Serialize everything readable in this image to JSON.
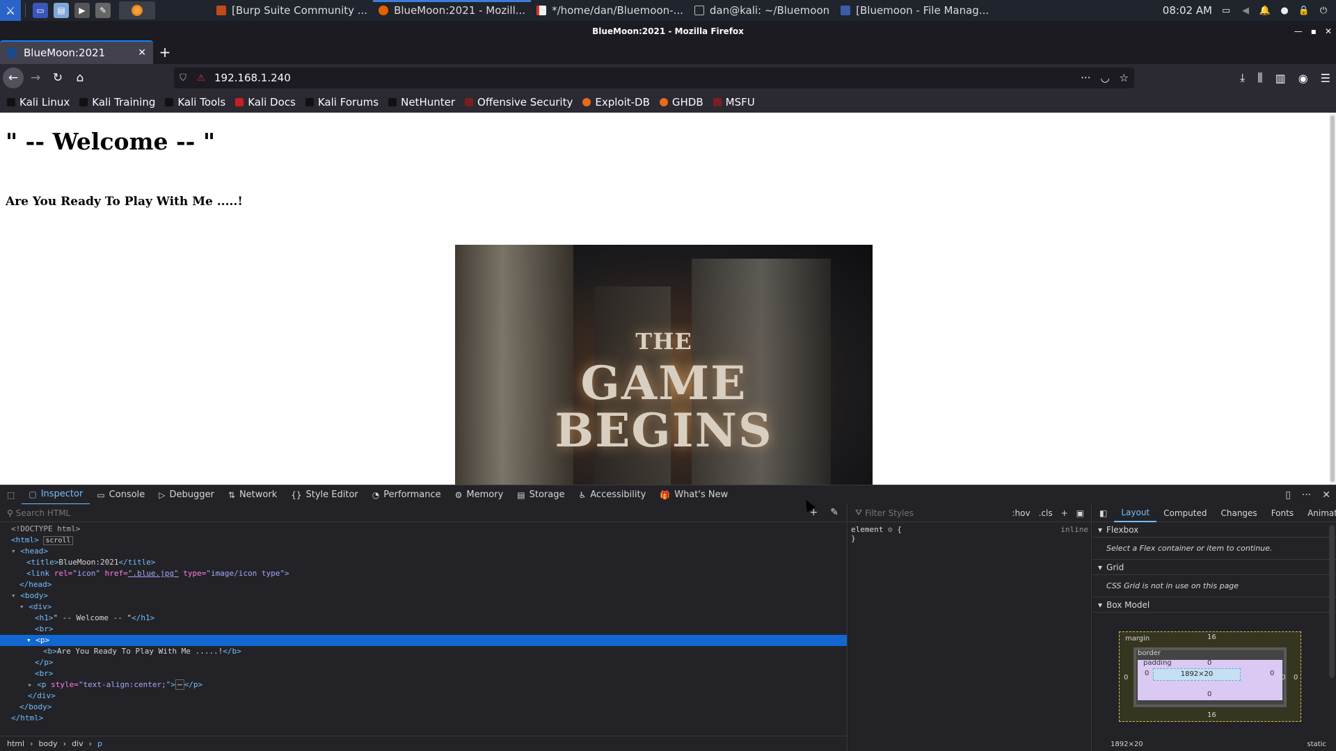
{
  "taskbar": {
    "windows": [
      {
        "label": "[Burp Suite Community ...",
        "color": "#c04a1a"
      },
      {
        "label": "BlueMoon:2021 - Mozill...",
        "color": "#e66000",
        "active": true
      },
      {
        "label": "*/home/dan/Bluemoon-...",
        "color": "#d33"
      },
      {
        "label": "dan@kali: ~/Bluemoon",
        "color": "#444"
      },
      {
        "label": "[Bluemoon - File Manag...",
        "color": "#3b5ca8"
      }
    ],
    "clock": "08:02 AM"
  },
  "firefox": {
    "window_title": "BlueMoon:2021 - Mozilla Firefox",
    "tab_title": "BlueMoon:2021",
    "url": "192.168.1.240",
    "bookmarks": [
      {
        "label": "Kali Linux",
        "color": "#111"
      },
      {
        "label": "Kali Training",
        "color": "#111"
      },
      {
        "label": "Kali Tools",
        "color": "#111"
      },
      {
        "label": "Kali Docs",
        "color": "#c81d25"
      },
      {
        "label": "Kali Forums",
        "color": "#111"
      },
      {
        "label": "NetHunter",
        "color": "#111"
      },
      {
        "label": "Offensive Security",
        "color": "#7a1f1f"
      },
      {
        "label": "Exploit-DB",
        "color": "#e86a1a"
      },
      {
        "label": "GHDB",
        "color": "#e86a1a"
      },
      {
        "label": "MSFU",
        "color": "#7a1f1f"
      }
    ]
  },
  "page": {
    "heading": "\" -- Welcome -- \"",
    "subheading": "Are You Ready To Play With Me .....!",
    "hero": {
      "line1": "THE",
      "line2": "GAME",
      "line3": "BEGINS"
    }
  },
  "devtools": {
    "tabs": [
      "Inspector",
      "Console",
      "Debugger",
      "Network",
      "Style Editor",
      "Performance",
      "Memory",
      "Storage",
      "Accessibility",
      "What's New"
    ],
    "search_placeholder": "Search HTML",
    "filter_placeholder": "Filter Styles",
    "hov": ":hov",
    "cls": ".cls",
    "breadcrumbs": [
      "html",
      "body",
      "div",
      "p"
    ],
    "rule_selector": "element",
    "rule_open": "{",
    "rule_close": "}",
    "rule_display": "inline",
    "side_tabs": [
      "Layout",
      "Computed",
      "Changes",
      "Fonts",
      "Animat"
    ],
    "flexbox_title": "Flexbox",
    "flexbox_msg": "Select a Flex container or item to continue.",
    "grid_title": "Grid",
    "grid_msg": "CSS Grid is not in use on this page",
    "boxmodel_title": "Box Model",
    "box": {
      "margin_label": "margin",
      "border_label": "border",
      "padding_label": "padding",
      "margin_top": "16",
      "margin_bottom": "16",
      "margin_side": "0",
      "zero": "0",
      "content": "1892×20",
      "footer_size": "1892×20",
      "footer_position": "static"
    },
    "tree": {
      "doctype": "<!DOCTYPE html>",
      "html_open": "<html>",
      "scroll_badge": "scroll",
      "head_open": "<head>",
      "title_tag": "<title>",
      "title_text": "BlueMoon:2021",
      "title_close": "</title>",
      "link_tag": "<link",
      "rel_attr": "rel=",
      "rel_val": "\"icon\"",
      "href_attr": "href=",
      "href_val": ".blue.jpg",
      "type_attr": "type=",
      "type_val": "\"image/icon type\"",
      "link_end": ">",
      "head_close": "</head>",
      "body_open": "<body>",
      "div_open": "<div>",
      "h1_open": "<h1>",
      "h1_text": "\" -- Welcome -- \"",
      "h1_close": "</h1>",
      "br": "<br>",
      "p_open": "<p>",
      "b_open": "<b>",
      "b_text": "Are You Ready To Play With Me .....!",
      "b_close": "</b>",
      "p_close": "</p>",
      "p2_tag": "<p",
      "style_attr": "style=",
      "style_val": "\"text-align:center;\"",
      "p2_end": ">",
      "ellipsis": "⋯",
      "div_close": "</div>",
      "body_close": "</body>",
      "html_close": "</html>"
    }
  }
}
